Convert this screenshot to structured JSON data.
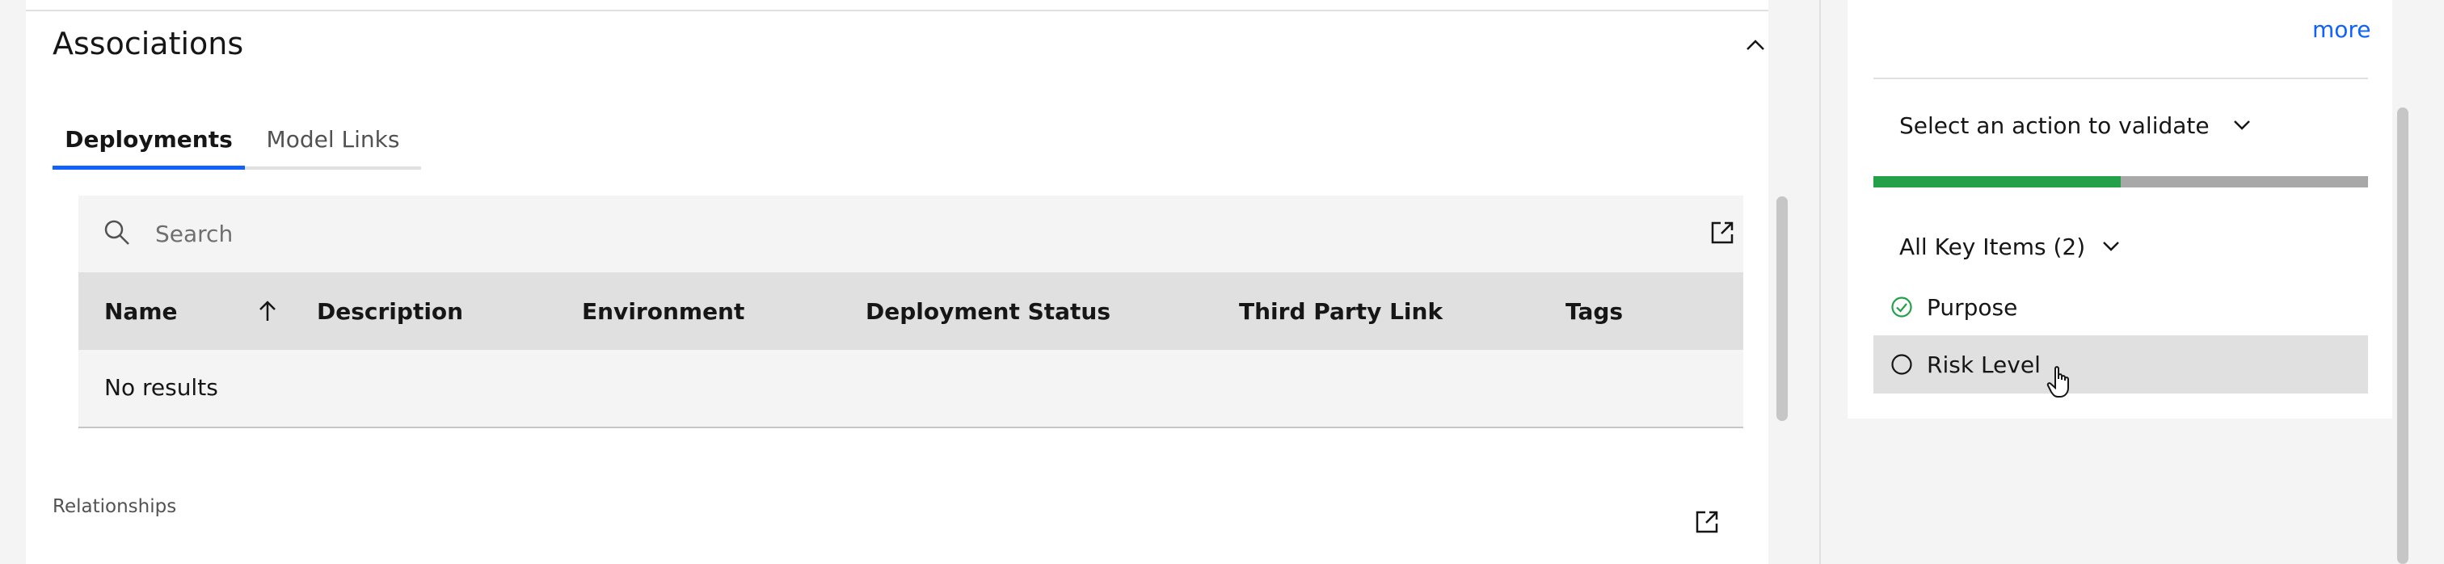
{
  "associations": {
    "title": "Associations",
    "tabs": [
      {
        "label": "Deployments",
        "active": true
      },
      {
        "label": "Model Links",
        "active": false
      }
    ],
    "search": {
      "placeholder": "Search",
      "value": ""
    },
    "table": {
      "columns": [
        "Name",
        "Description",
        "Environment",
        "Deployment Status",
        "Third Party Link",
        "Tags"
      ],
      "sorted_column": "Name",
      "sort_direction": "ascending",
      "empty_text": "No results"
    },
    "relationships_label": "Relationships"
  },
  "side_panel": {
    "more_link": "more",
    "action_dropdown": {
      "label": "Select an action to validate"
    },
    "progress": {
      "completed": 1,
      "total": 2,
      "fraction": 0.5,
      "fill_color": "#24a148",
      "track_color": "#a8a8a8"
    },
    "key_items_dropdown": {
      "label": "All Key Items (2)"
    },
    "key_items": [
      {
        "label": "Purpose",
        "status": "complete",
        "icon": "checkmark-circle-icon"
      },
      {
        "label": "Risk Level",
        "status": "incomplete",
        "icon": "empty-circle-icon"
      }
    ]
  },
  "colors": {
    "accent": "#0f62fe",
    "success": "#24a148"
  }
}
